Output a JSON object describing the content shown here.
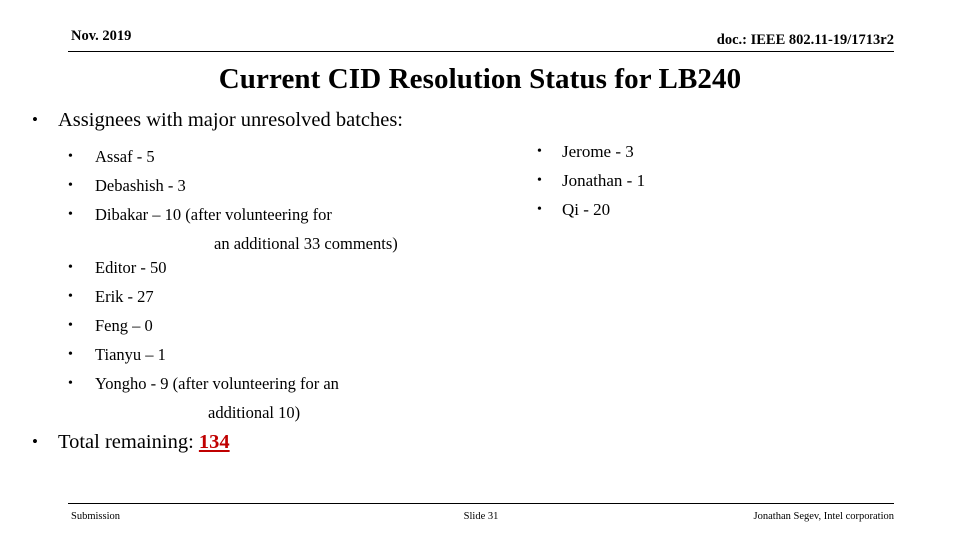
{
  "header": {
    "date": "Nov. 2019",
    "doc_reference": "doc.: IEEE 802.11-19/1713r2"
  },
  "title": "Current CID Resolution Status for LB240",
  "body": {
    "main_bullet": "Assignees with major unresolved batches:",
    "bullet_glyph": "•",
    "left_column_group1": [
      {
        "label": "Assaf - 5",
        "continuation": null
      },
      {
        "label": "Debashish - 3",
        "continuation": null
      },
      {
        "label": "Dibakar –  10 (after volunteering for",
        "continuation": "an additional 33 comments)"
      }
    ],
    "left_column_group2": [
      {
        "label": "Editor - 50",
        "continuation": null
      },
      {
        "label": "Erik - 27",
        "continuation": null
      },
      {
        "label": "Feng – 0",
        "continuation": null
      },
      {
        "label": "Tianyu – 1",
        "continuation": null
      },
      {
        "label": "Yongho - 9 (after volunteering for an",
        "continuation": "additional 10)"
      }
    ],
    "right_column": [
      {
        "label": "Jerome - 3"
      },
      {
        "label": "Jonathan - 1"
      },
      {
        "label": "Qi - 20"
      }
    ],
    "total": {
      "prefix": "Total remaining: ",
      "value": "134",
      "value_color": "#C00000"
    }
  },
  "footer": {
    "left": "Submission",
    "center": "Slide 31",
    "right": "Jonathan Segev, Intel corporation"
  }
}
